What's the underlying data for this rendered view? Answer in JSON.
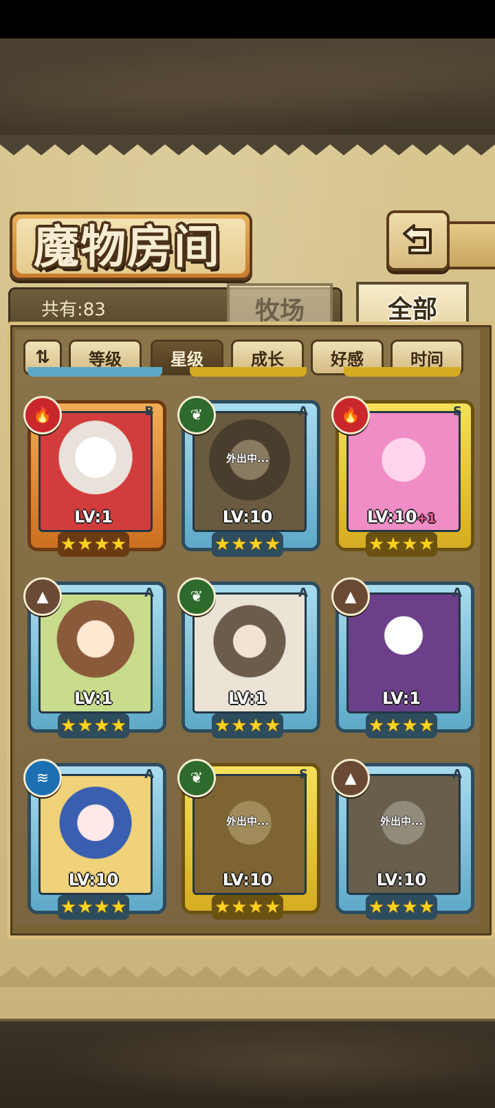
{
  "header": {
    "title": "魔物房间"
  },
  "count": {
    "label": "共有:83"
  },
  "tabs": [
    {
      "label": "牧场",
      "active": false
    },
    {
      "label": "全部",
      "active": true
    }
  ],
  "filters": [
    {
      "label": "等级",
      "active": false
    },
    {
      "label": "星级",
      "active": true
    },
    {
      "label": "成长",
      "active": false
    },
    {
      "label": "好感",
      "active": false
    },
    {
      "label": "时间",
      "active": false
    }
  ],
  "monsters": [
    {
      "element": "fire",
      "rank": "B",
      "level": "LV:1",
      "plus": "",
      "away": "",
      "stars": 4,
      "frame": "orange"
    },
    {
      "element": "leaf",
      "rank": "A",
      "level": "LV:10",
      "plus": "",
      "away": "外出中...",
      "stars": 4,
      "frame": "blue"
    },
    {
      "element": "fire",
      "rank": "S",
      "level": "LV:10",
      "plus": "+1",
      "away": "",
      "stars": 4,
      "frame": "gold"
    },
    {
      "element": "rock",
      "rank": "A",
      "level": "LV:1",
      "plus": "",
      "away": "",
      "stars": 4,
      "frame": "blue"
    },
    {
      "element": "leaf",
      "rank": "A",
      "level": "LV:1",
      "plus": "",
      "away": "",
      "stars": 4,
      "frame": "blue"
    },
    {
      "element": "rock",
      "rank": "A",
      "level": "LV:1",
      "plus": "",
      "away": "",
      "stars": 4,
      "frame": "blue"
    },
    {
      "element": "water",
      "rank": "A",
      "level": "LV:10",
      "plus": "",
      "away": "",
      "stars": 4,
      "frame": "blue"
    },
    {
      "element": "leaf",
      "rank": "S",
      "level": "LV:10",
      "plus": "",
      "away": "外出中...",
      "stars": 4,
      "frame": "gold"
    },
    {
      "element": "rock",
      "rank": "A",
      "level": "LV:10",
      "plus": "",
      "away": "外出中...",
      "stars": 4,
      "frame": "blue"
    }
  ]
}
